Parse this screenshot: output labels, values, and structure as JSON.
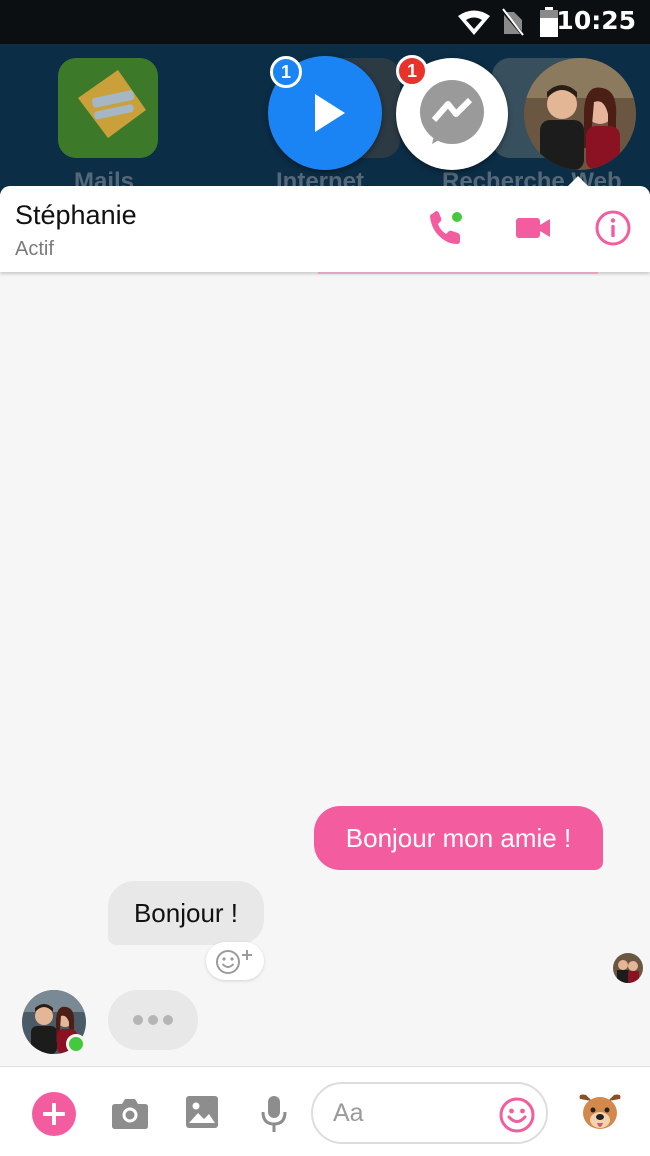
{
  "status_bar": {
    "time": "10:25"
  },
  "launcher": {
    "labels": [
      "Mails",
      "Internet",
      "Recherche Web"
    ]
  },
  "chat_heads": {
    "video_badge": "1",
    "messenger_badge": "1"
  },
  "header": {
    "contact_name": "Stéphanie",
    "contact_status": "Actif"
  },
  "conversation": {
    "messages": [
      {
        "direction": "outgoing",
        "text": "Bonjour mon amie !"
      },
      {
        "direction": "incoming",
        "text": "Bonjour !"
      }
    ]
  },
  "composer": {
    "placeholder": "Aa"
  },
  "colors": {
    "accent": "#f35d9f",
    "online": "#44c93c",
    "messenger_blue": "#1a84f5",
    "badge_red": "#e8322c"
  },
  "icons": [
    "wifi-icon",
    "no-sim-icon",
    "battery-icon",
    "play-icon",
    "messenger-icon",
    "phone-icon",
    "video-call-icon",
    "info-icon",
    "add-emoji-reaction-icon",
    "plus-icon",
    "camera-icon",
    "image-icon",
    "microphone-icon",
    "emoji-icon",
    "dog-sticker-icon"
  ]
}
